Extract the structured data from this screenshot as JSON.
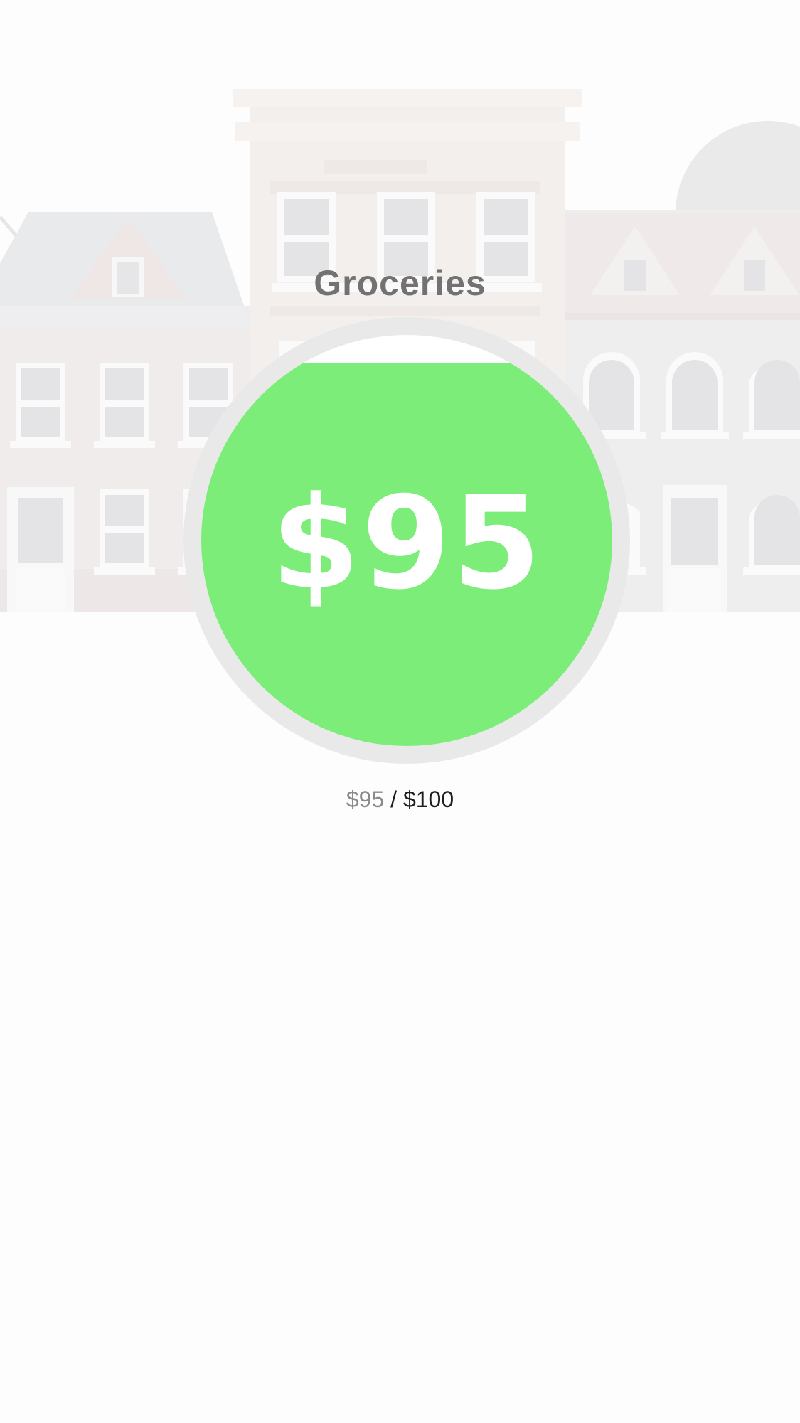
{
  "category": {
    "title": "Groceries"
  },
  "gauge": {
    "amount_label": "$95",
    "fill_fraction": 0.93,
    "fill_color": "#7ced78",
    "ring_color": "#e9e9e9",
    "text_color": "#ffffff"
  },
  "summary": {
    "spent": "$95",
    "separator": " / ",
    "budget": "$100"
  },
  "background": {
    "illustration": "row-of-townhouses"
  }
}
